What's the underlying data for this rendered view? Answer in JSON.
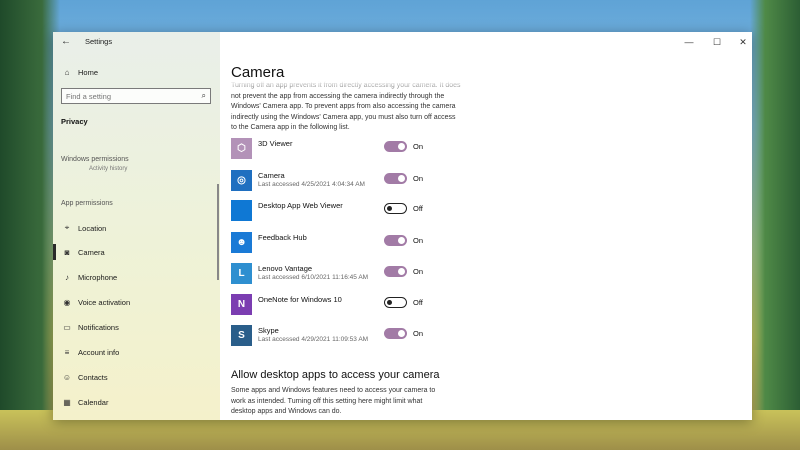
{
  "window": {
    "title": "Settings",
    "minimize_glyph": "—",
    "maximize_glyph": "☐",
    "close_glyph": "✕"
  },
  "sidebar": {
    "home_label": "Home",
    "search_placeholder": "Find a setting",
    "category": "Privacy",
    "windows_permissions_header": "Windows permissions",
    "partial_item": "Activity history",
    "app_permissions_header": "App permissions",
    "items": [
      {
        "label": "Location",
        "icon": "location-icon"
      },
      {
        "label": "Camera",
        "icon": "camera-icon",
        "selected": true
      },
      {
        "label": "Microphone",
        "icon": "microphone-icon"
      },
      {
        "label": "Voice activation",
        "icon": "voice-activation-icon"
      },
      {
        "label": "Notifications",
        "icon": "notifications-icon"
      },
      {
        "label": "Account info",
        "icon": "account-info-icon"
      },
      {
        "label": "Contacts",
        "icon": "contacts-icon"
      },
      {
        "label": "Calendar",
        "icon": "calendar-icon"
      }
    ]
  },
  "main": {
    "title": "Camera",
    "intro_text": "Turning off an app prevents it from directly accessing your camera. It does not prevent the app from accessing the camera indirectly through the Windows' Camera app. To prevent apps from also accessing the camera indirectly using the Windows' Camera app, you must also turn off access to the Camera app in the following list.",
    "apps": [
      {
        "name": "3D Viewer",
        "last_accessed": "",
        "state": "On",
        "on": true,
        "tile_color": "#b392b8",
        "icon": "3d-viewer-icon"
      },
      {
        "name": "Camera",
        "last_accessed": "Last accessed 4/25/2021 4:04:34 AM",
        "state": "On",
        "on": true,
        "tile_color": "#1f6fc0",
        "icon": "camera-app-icon"
      },
      {
        "name": "Desktop App Web Viewer",
        "last_accessed": "",
        "state": "Off",
        "on": false,
        "tile_color": "#0f78d4",
        "icon": "web-viewer-icon"
      },
      {
        "name": "Feedback Hub",
        "last_accessed": "",
        "state": "On",
        "on": true,
        "tile_color": "#1a7ad6",
        "icon": "feedback-hub-icon"
      },
      {
        "name": "Lenovo Vantage",
        "last_accessed": "Last accessed 6/10/2021 11:16:45 AM",
        "state": "On",
        "on": true,
        "tile_color": "#2e8fd0",
        "icon": "lenovo-vantage-icon"
      },
      {
        "name": "OneNote for Windows 10",
        "last_accessed": "",
        "state": "Off",
        "on": false,
        "tile_color": "#7b3db1",
        "icon": "onenote-icon"
      },
      {
        "name": "Skype",
        "last_accessed": "Last accessed 4/29/2021 11:09:53 AM",
        "state": "On",
        "on": true,
        "tile_color": "#2a5e8a",
        "icon": "skype-icon"
      }
    ],
    "section2_title": "Allow desktop apps to access your camera",
    "section2_desc": "Some apps and Windows features need to access your camera to work as intended. Turning off this setting here might limit what desktop apps and Windows can do."
  },
  "colors": {
    "accent": "#a27ba6"
  }
}
